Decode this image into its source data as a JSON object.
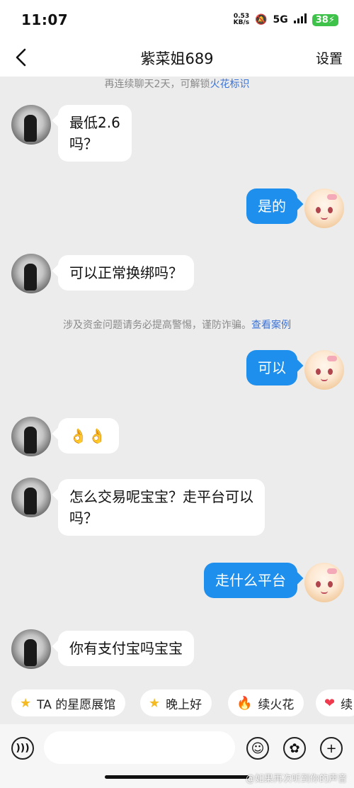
{
  "status_bar": {
    "time": "11:07",
    "net_speed_value": "0.53",
    "net_speed_unit": "KB/s",
    "network": "5G",
    "battery": "38"
  },
  "header": {
    "title": "紫菜姐689",
    "settings_label": "设置"
  },
  "chat": {
    "streak_note": "再连续聊天2天，可解锁",
    "streak_link": "火花标识",
    "safety_note": "涉及资金问题请务必提高警惕，谨防诈骗。",
    "safety_link": "查看案例",
    "messages": [
      {
        "from": "them",
        "text": "最低2.6吗？",
        "line1": "最低2.6",
        "line2": "吗？"
      },
      {
        "from": "me",
        "text": "是的"
      },
      {
        "from": "them",
        "text": "可以正常换绑吗？"
      },
      {
        "from": "me",
        "text": "可以"
      },
      {
        "from": "them",
        "text": "👌👌"
      },
      {
        "from": "them",
        "line1": "怎么交易呢宝宝？走平台可以",
        "line2": "吗？"
      },
      {
        "from": "me",
        "text": "走什么平台"
      },
      {
        "from": "them",
        "text": "你有支付宝吗宝宝"
      }
    ]
  },
  "quick_actions": [
    {
      "label": "TA 的星愿展馆",
      "icon": "star-icon"
    },
    {
      "label": "晚上好",
      "icon": "star-icon"
    },
    {
      "label": "续火花",
      "icon": "fire-icon"
    },
    {
      "label": "续",
      "icon": "heart-icon"
    }
  ],
  "input_bar": {
    "placeholder": "",
    "value": ""
  },
  "watermark": "@如果再次听到你的声音",
  "colors": {
    "accent": "#1f8fee",
    "link": "#3b73d8",
    "background": "#ececec",
    "battery": "#3ec24a"
  }
}
